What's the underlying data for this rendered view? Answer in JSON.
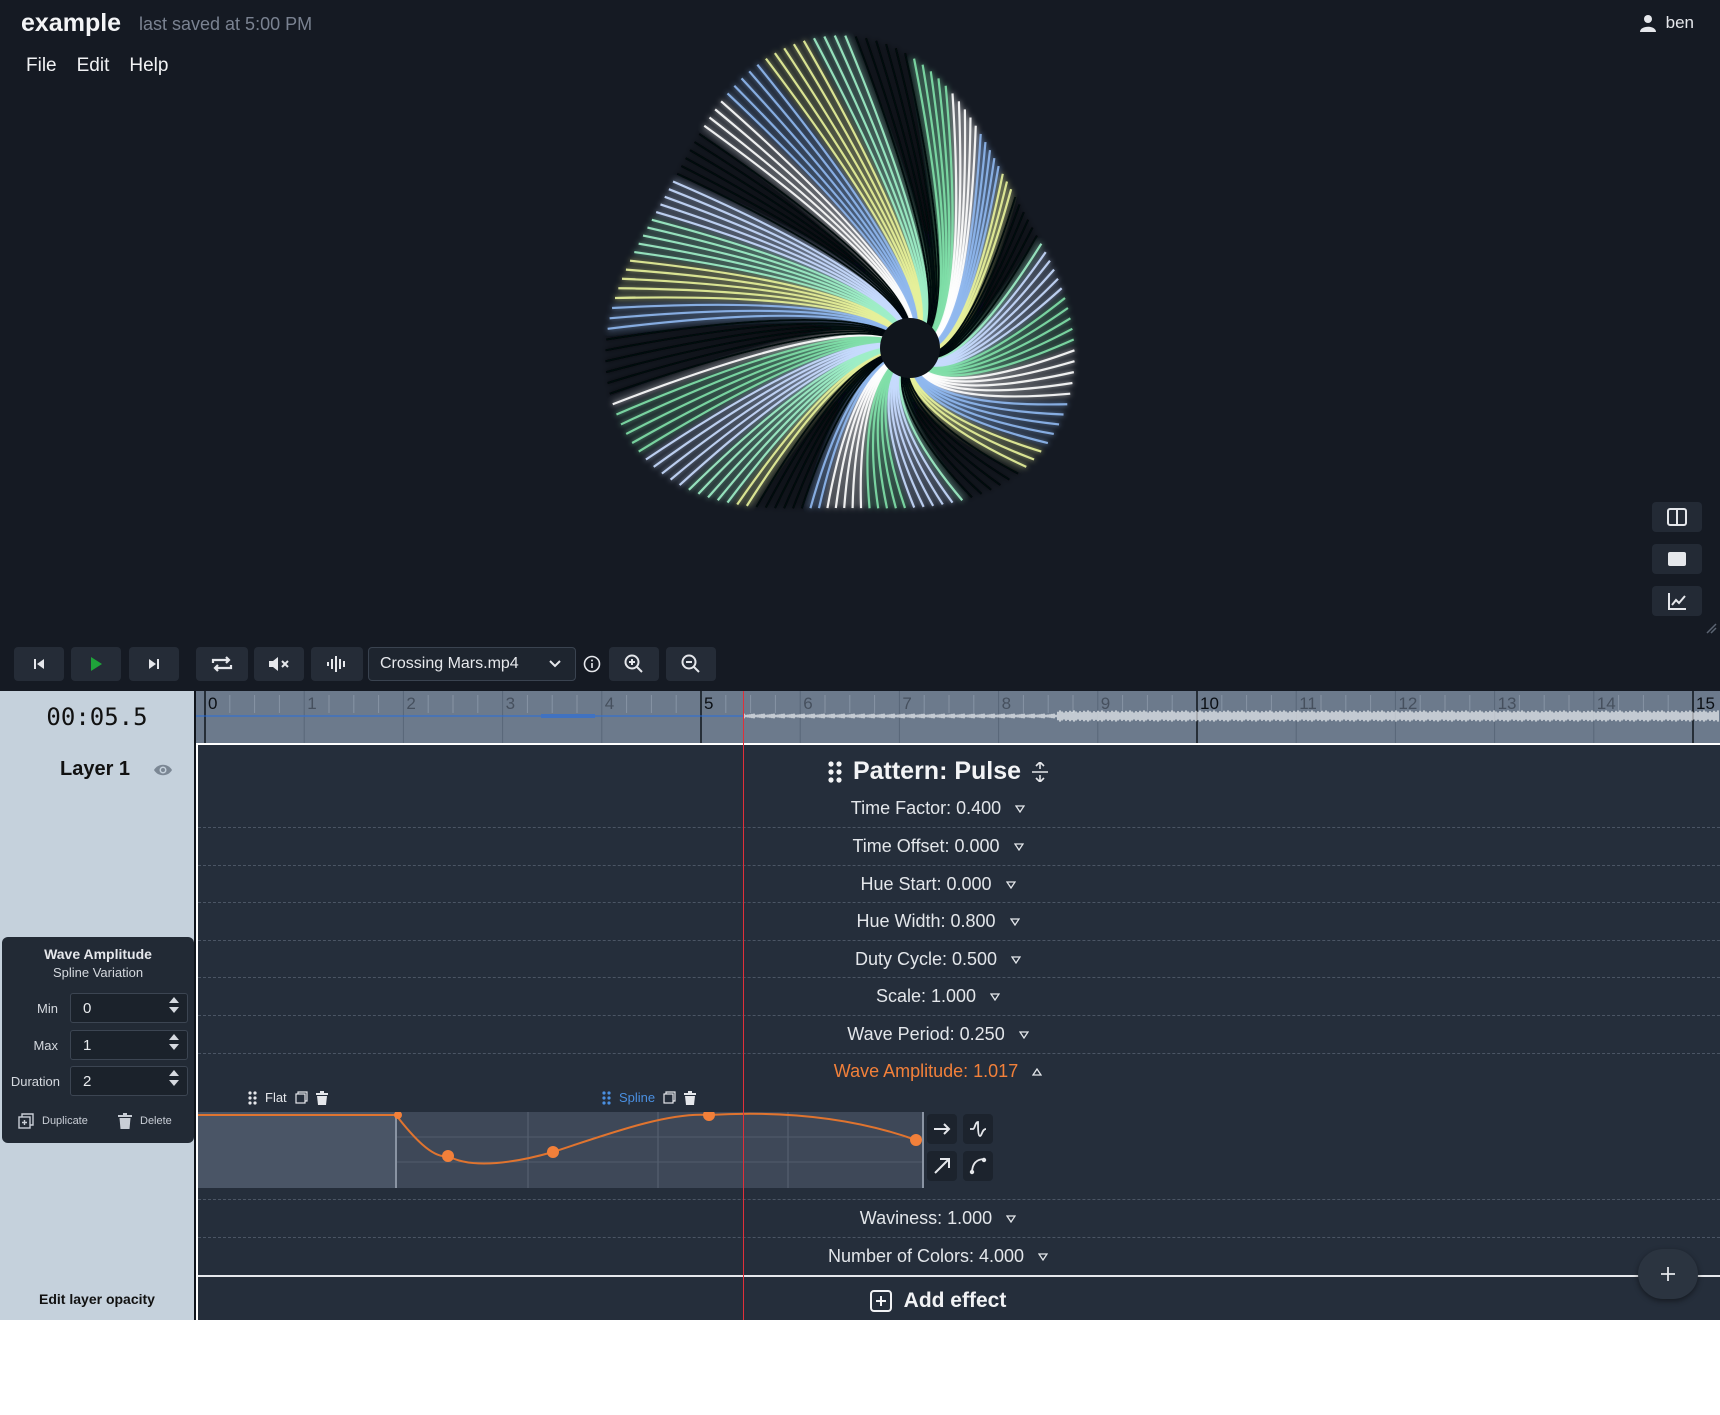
{
  "app": {
    "title": "example",
    "saved_status": "last saved at 5:00 PM",
    "user": "ben"
  },
  "menu": [
    "File",
    "Edit",
    "Help"
  ],
  "transport": {
    "media_file": "Crossing Mars.mp4",
    "buttons": [
      "skip-back",
      "play",
      "skip-forward",
      "loop",
      "mute",
      "waveform",
      "info",
      "zoom-in",
      "zoom-out"
    ]
  },
  "timeline": {
    "timecode": "00:05.5",
    "ruler_labels": [
      "0",
      "1",
      "2",
      "3",
      "4",
      "5",
      "6",
      "7",
      "8",
      "9",
      "10",
      "11",
      "12",
      "13",
      "14",
      "15"
    ],
    "playhead_seconds": 5.5
  },
  "layer": {
    "name": "Layer 1",
    "edit_opacity": "Edit layer opacity"
  },
  "variation": {
    "title": "Wave Amplitude",
    "subtitle": "Spline Variation",
    "min_label": "Min",
    "min_value": "0",
    "max_label": "Max",
    "max_value": "1",
    "duration_label": "Duration",
    "duration_value": "2",
    "duplicate": "Duplicate",
    "delete": "Delete"
  },
  "pattern": {
    "title": "Pattern: Pulse",
    "params": [
      "Time Factor: 0.400",
      "Time Offset: 0.000",
      "Hue Start: 0.000",
      "Hue Width: 0.800",
      "Duty Cycle: 0.500",
      "Scale: 1.000",
      "Wave Period: 0.250",
      "Wave Amplitude: 1.017",
      "Waviness: 1.000",
      "Number of Colors: 4.000"
    ],
    "active_param": "Wave Amplitude: 1.017",
    "segments": [
      "Flat",
      "Spline"
    ],
    "add_effect": "Add effect"
  },
  "colors": {
    "bg": "#151a23",
    "track": "#252e3b",
    "accent_orange": "#f2803a",
    "accent_blue": "#4a8fe0",
    "playhead": "#e0303a",
    "panel": "#c5d1dc"
  }
}
